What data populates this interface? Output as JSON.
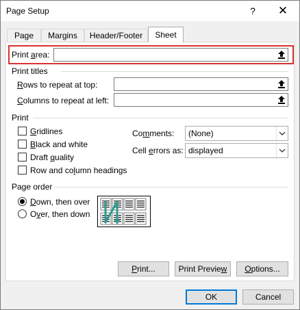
{
  "window": {
    "title": "Page Setup",
    "help_glyph": "?",
    "close_glyph": "✕"
  },
  "tabs": [
    {
      "label": "Page",
      "active": false
    },
    {
      "label": "Margins",
      "active": false
    },
    {
      "label": "Header/Footer",
      "active": false
    },
    {
      "label": "Sheet",
      "active": true
    }
  ],
  "print_area": {
    "label_pre": "Print ",
    "label_u": "a",
    "label_post": "rea:",
    "value": "",
    "highlight_color": "#d8332f"
  },
  "print_titles": {
    "heading": "Print titles",
    "rows": {
      "label_u": "R",
      "label_post": "ows to repeat at top:",
      "value": ""
    },
    "columns": {
      "label_u": "C",
      "label_post": "olumns to repeat at left:",
      "value": ""
    }
  },
  "print": {
    "heading": "Print",
    "gridlines": {
      "label_u": "G",
      "label_post": "ridlines",
      "checked": false
    },
    "black_white": {
      "label_u": "B",
      "label_post": "lack and white",
      "checked": false
    },
    "draft": {
      "label_pre": "Draft ",
      "label_u": "q",
      "label_post": "uality",
      "checked": false
    },
    "headings": {
      "label_pre": "Row and co",
      "label_u": "l",
      "label_post": "umn headings",
      "checked": false
    },
    "comments": {
      "label_pre": "Co",
      "label_u": "m",
      "label_post": "ments:",
      "value": "(None)"
    },
    "cell_errors": {
      "label_pre": "Cell ",
      "label_u": "e",
      "label_post": "rrors as:",
      "value": "displayed"
    }
  },
  "page_order": {
    "heading": "Page order",
    "down_then_over": {
      "label_u": "D",
      "label_post": "own, then over",
      "selected": true
    },
    "over_then_down": {
      "label_pre": "O",
      "label_u": "v",
      "label_post": "er, then down",
      "selected": false
    },
    "arrow_color": "#2e9c8f"
  },
  "buttons": {
    "print": {
      "label_u": "P",
      "label_post": "rint..."
    },
    "preview": {
      "label_pre": "Print Previe",
      "label_u": "w",
      "label_post": ""
    },
    "options": {
      "label_u": "O",
      "label_post": "ptions..."
    },
    "ok": "OK",
    "cancel": "Cancel"
  }
}
